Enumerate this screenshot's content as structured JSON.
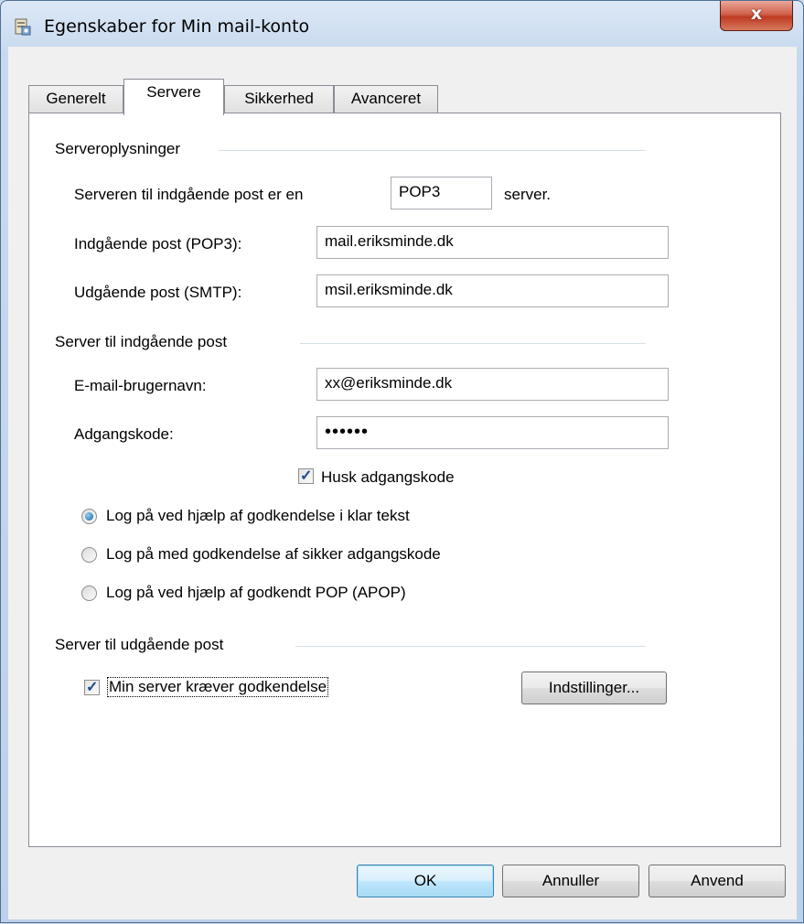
{
  "window": {
    "title": "Egenskaber for Min mail-konto",
    "close_label": "x"
  },
  "tabs": [
    "Generelt",
    "Servere",
    "Sikkerhed",
    "Avanceret"
  ],
  "server_info": {
    "group_label": "Serveroplysninger",
    "incoming_type_prefix": "Serveren til indgående post er en",
    "incoming_type_value": "POP3",
    "incoming_type_suffix": "server.",
    "incoming_label": "Indgående post (POP3):",
    "incoming_value": "mail.eriksminde.dk",
    "outgoing_label": "Udgående post (SMTP):",
    "outgoing_value": "msil.eriksminde.dk"
  },
  "incoming_server": {
    "group_label": "Server til indgående post",
    "username_label": "E-mail-brugernavn:",
    "username_value": "xx@eriksminde.dk",
    "password_label": "Adgangskode:",
    "password_value": "••••••",
    "remember_label": "Husk adgangskode",
    "remember_checked": true,
    "auth_options": [
      {
        "label": "Log på ved hjælp af godkendelse i klar tekst",
        "selected": true
      },
      {
        "label": "Log på med godkendelse af sikker adgangskode",
        "selected": false
      },
      {
        "label": "Log på ved hjælp af godkendt POP (APOP)",
        "selected": false
      }
    ]
  },
  "outgoing_server": {
    "group_label": "Server til udgående post",
    "requires_auth_label": "Min server kræver godkendelse",
    "requires_auth_checked": true,
    "settings_button": "Indstillinger..."
  },
  "buttons": {
    "ok": "OK",
    "cancel": "Annuller",
    "apply": "Anvend"
  },
  "colors": {
    "title_gradient_top": "#dce8f6",
    "close_red": "#c8432a",
    "accent_blue": "#3c7fb1"
  },
  "icons": {
    "title": "account-properties-icon",
    "close": "close-icon"
  }
}
